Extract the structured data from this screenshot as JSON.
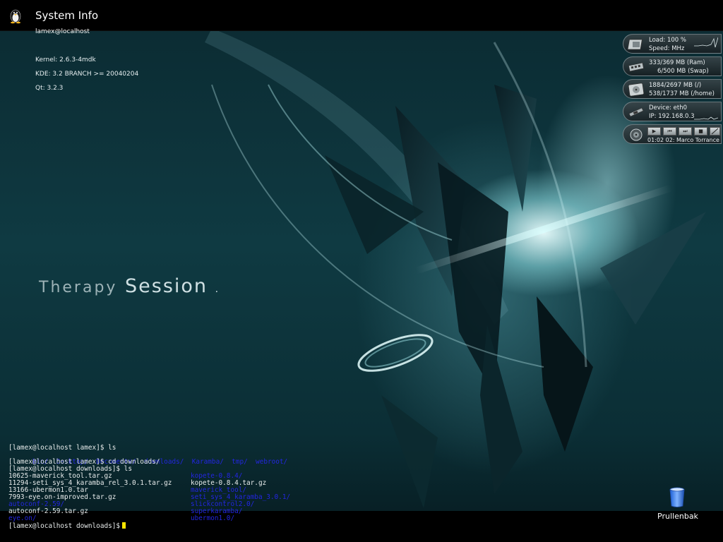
{
  "topbar": {
    "title": "System Info",
    "user_host": "lamex@localhost"
  },
  "info": {
    "kernel": "Kernel: 2.6.3-4mdk",
    "kde": "KDE: 3.2 BRANCH >= 20040204",
    "qt": "Qt: 3.2.3"
  },
  "theme": {
    "title_a": "Therapy",
    "title_b": "Session",
    "dot": "."
  },
  "widgets": {
    "cpu": {
      "load": "Load:      100 %",
      "speed": "Speed:          MHz"
    },
    "memory": {
      "ram": "333/369 MB (Ram)",
      "swap": "6/500 MB (Swap)"
    },
    "disk": {
      "root": "1884/2697 MB (/)",
      "home": "538/1737 MB (/home)"
    },
    "network": {
      "device": "Device: eth0",
      "ip": "IP: 192.168.0.3"
    },
    "media": {
      "status": "01:02  02: Marco Torrance",
      "buttons": [
        "▶",
        "⏮",
        "⏭",
        "■"
      ]
    }
  },
  "terminal": {
    "lines": [
      {
        "text": "[lamex@localhost lamex]$ ls"
      },
      {
        "dirs": [
          "bin/",
          "Desktop/",
          "Documents/",
          "downloads/",
          "Karamba/",
          "tmp/",
          "webroot/"
        ]
      },
      {
        "text": "[lamex@localhost lamex]$ cd downloads/"
      },
      {
        "text": "[lamex@localhost downloads]$ ls"
      }
    ],
    "listing": [
      {
        "left": "10625-maverick_tool.tar.gz",
        "right": "kopete-0.8.4/",
        "left_dir": false,
        "right_dir": true
      },
      {
        "left": "11294-seti_sys_4_karamba_rel_3.0.1.tar.gz",
        "right": "kopete-0.8.4.tar.gz",
        "left_dir": false,
        "right_dir": false
      },
      {
        "left": "13166-ubermon1.0.tar",
        "right": "maverick_tool/",
        "left_dir": false,
        "right_dir": true
      },
      {
        "left": "7993-eye.on-improved.tar.gz",
        "right": "seti_sys_4_karamba_3.0.1/",
        "left_dir": false,
        "right_dir": true
      },
      {
        "left": "autoconf-2.59/",
        "right": "slickcontrol2.0/",
        "left_dir": true,
        "right_dir": true
      },
      {
        "left": "autoconf-2.59.tar.gz",
        "right": "superkaramba/",
        "left_dir": false,
        "right_dir": true
      },
      {
        "left": "eye.on/",
        "right": "ubermon1.0/",
        "left_dir": true,
        "right_dir": true
      }
    ],
    "prompt": "[lamex@localhost downloads]$"
  },
  "trash": {
    "label": "Prullenbak"
  },
  "colors": {
    "background": "#0f3a42",
    "directory": "#2326e0",
    "cursor": "#ffe600"
  }
}
